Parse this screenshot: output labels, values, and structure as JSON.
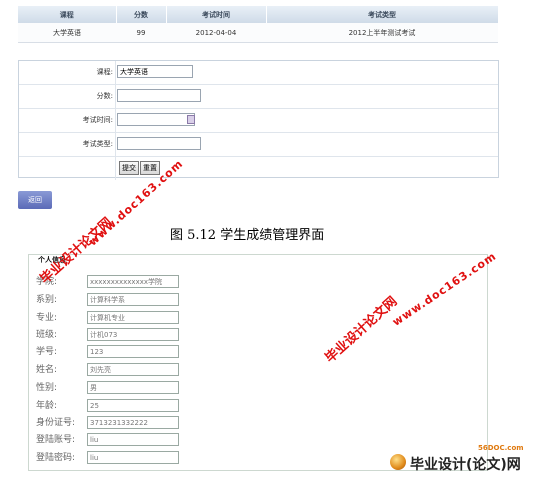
{
  "score_table": {
    "headers": [
      "课程",
      "分数",
      "考试时间",
      "考试类型"
    ],
    "row": [
      "大学英语",
      "99",
      "2012-04-04",
      "2012上半年测试考试"
    ]
  },
  "form": {
    "fields": [
      {
        "label": "课程:",
        "value": "大学英语"
      },
      {
        "label": "分数:",
        "value": ""
      },
      {
        "label": "考试时间:",
        "value": ""
      },
      {
        "label": "考试类型:",
        "value": ""
      }
    ],
    "submit_label": "提交",
    "reset_label": "重置"
  },
  "back_label": "返回",
  "caption": "图 5.12 学生成绩管理界面",
  "info": {
    "title": "个人信息",
    "rows": [
      {
        "label": "学院:",
        "value": "xxxxxxxxxxxxxx学院"
      },
      {
        "label": "系别:",
        "value": "计算科学系"
      },
      {
        "label": "专业:",
        "value": "计算机专业"
      },
      {
        "label": "班级:",
        "value": "计机073"
      },
      {
        "label": "学号:",
        "value": "123"
      },
      {
        "label": "姓名:",
        "value": "刘先亮"
      },
      {
        "label": "性别:",
        "value": "男"
      },
      {
        "label": "年龄:",
        "value": "25"
      },
      {
        "label": "身份证号:",
        "value": "3713231332222"
      },
      {
        "label": "登陆账号:",
        "value": "liu"
      },
      {
        "label": "登陆密码:",
        "value": "liu"
      }
    ]
  },
  "watermarks": {
    "cn": "毕业设计论文网",
    "url": "www.doc163.com",
    "footer_site": "56DOC.com",
    "footer_text": "毕业设计(论文)网",
    "color": "#e01010"
  }
}
